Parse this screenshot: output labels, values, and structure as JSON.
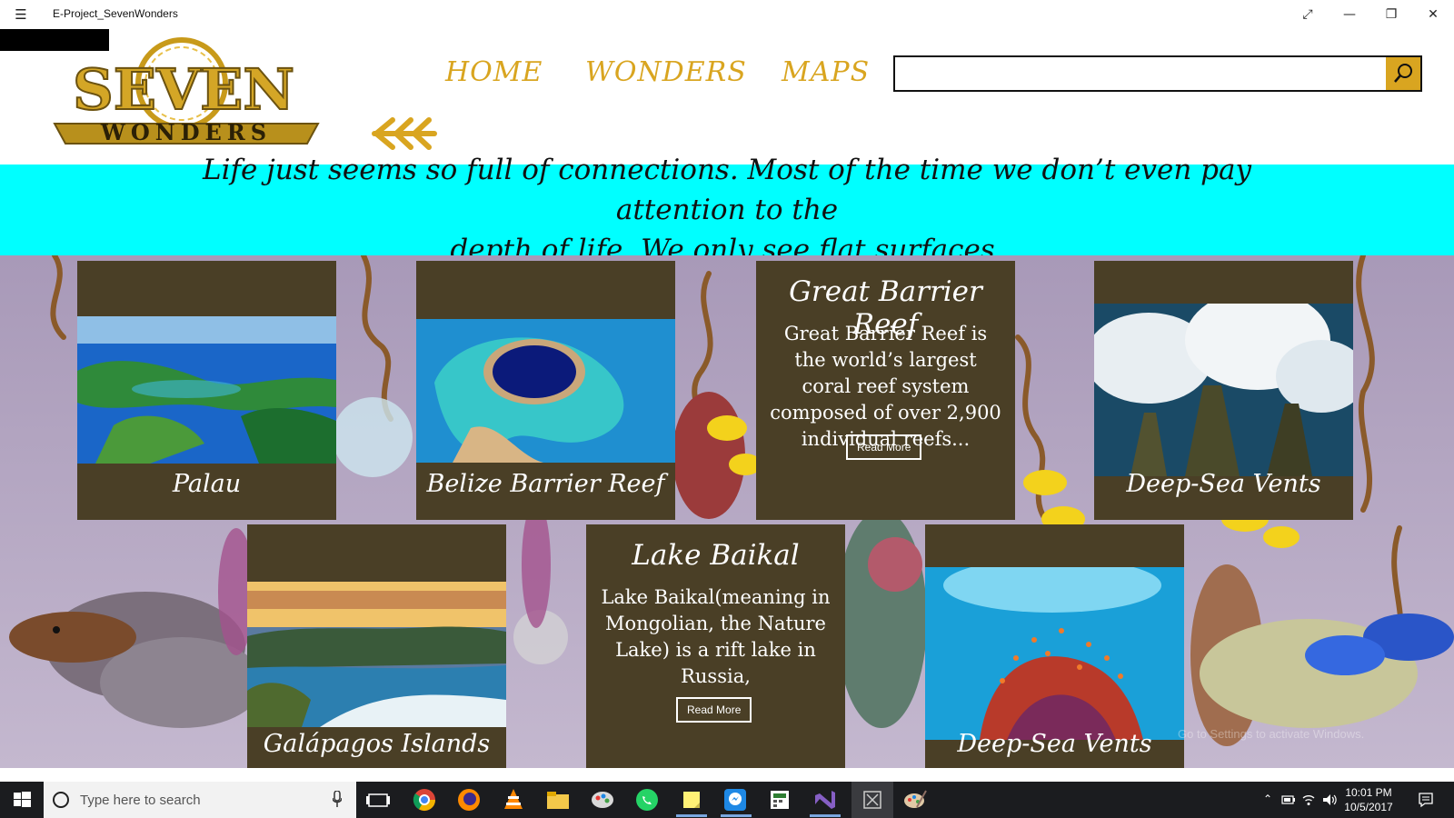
{
  "window": {
    "title": "E-Project_SevenWonders",
    "controls": [
      "fullscreen",
      "minimize",
      "restore",
      "close"
    ]
  },
  "header": {
    "logo_text_top": "SEVEN",
    "logo_text_bottom": "WONDERS",
    "nav": [
      {
        "label": "HOME"
      },
      {
        "label": "WONDERS"
      },
      {
        "label": "MAPS"
      }
    ],
    "back_icon": "double-arrow-left-icon",
    "search": {
      "value": "",
      "placeholder": "",
      "icon": "search-icon"
    }
  },
  "quote": {
    "line1": "Life just seems so full of connections.  Most of the time we don’t even pay attention to the",
    "line2": "depth of life.  We only see flat surfaces."
  },
  "cards_row1": [
    {
      "caption": "Palau",
      "photo": "palau-aerial-islands"
    },
    {
      "caption": "Belize Barrier Reef",
      "photo": "great-blue-hole"
    },
    {
      "title": "Great Barrier Reef",
      "description": "Great Barrier Reef is the world’s largest coral reef system composed of over 2,900 individual reefs...",
      "button": "Read More"
    },
    {
      "caption": "Deep-Sea Vents",
      "photo": "hydrothermal-vents"
    }
  ],
  "cards_row2": [
    {
      "caption": "Galápagos Islands",
      "photo": "galapagos-coast"
    },
    {
      "title": "Lake Baikal",
      "description": "Lake Baikal(meaning in Mongolian, the Nature Lake) is a rift lake in Russia,",
      "button": "Read More"
    },
    {
      "caption": "Deep-Sea Vents",
      "photo": "coral-reef-fish"
    }
  ],
  "taskbar": {
    "search_placeholder": "Type here to search",
    "apps": [
      "task-view-icon",
      "chrome-icon",
      "firefox-icon",
      "vlc-icon",
      "file-explorer-icon",
      "paint-icon",
      "whatsapp-icon",
      "sticky-notes-icon",
      "messenger-icon",
      "calculator-icon",
      "visual-studio-icon",
      "app-window-icon",
      "paint-brush-icon"
    ],
    "time": "10:01 PM",
    "date": "10/5/2017"
  },
  "watermark": "Go to Settings to activate Windows.",
  "colors": {
    "accent_gold": "#d9a520",
    "banner_cyan": "#00ffff",
    "card_brown": "#4a3f26"
  }
}
